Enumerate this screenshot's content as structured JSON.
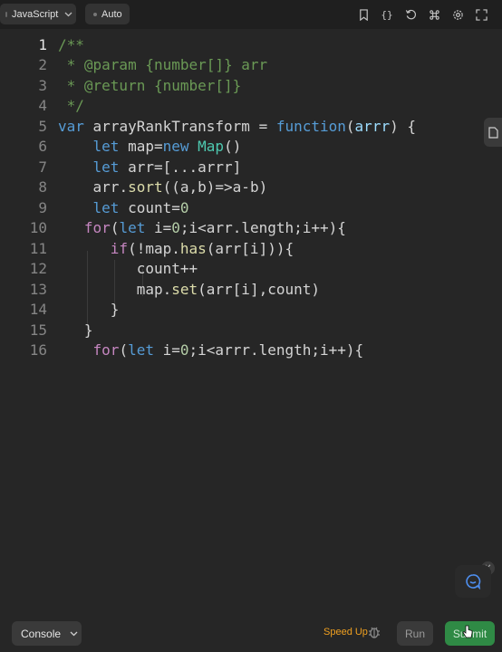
{
  "toolbar": {
    "language_label": "JavaScript",
    "mode_label": "Auto",
    "icons": [
      "bookmark-icon",
      "braces-icon",
      "reset-icon",
      "command-icon",
      "settings-icon",
      "expand-icon"
    ]
  },
  "editor": {
    "active_line": "1",
    "lines": [
      {
        "num": "1",
        "tokens": [
          {
            "t": "/**",
            "c": "#6a9955"
          }
        ]
      },
      {
        "num": "2",
        "tokens": [
          {
            "t": " * @param {number[]} arr",
            "c": "#6a9955"
          }
        ]
      },
      {
        "num": "3",
        "tokens": [
          {
            "t": " * @return {number[]}",
            "c": "#6a9955"
          }
        ]
      },
      {
        "num": "4",
        "tokens": [
          {
            "t": " */",
            "c": "#6a9955"
          }
        ]
      },
      {
        "num": "5",
        "tokens": [
          {
            "t": "var",
            "c": "#569cd6"
          },
          {
            "t": " ",
            "c": "#d4d4d4"
          },
          {
            "t": "arrayRankTransform",
            "c": "#d4d4d4"
          },
          {
            "t": " = ",
            "c": "#d4d4d4"
          },
          {
            "t": "function",
            "c": "#569cd6"
          },
          {
            "t": "(",
            "c": "#d4d4d4"
          },
          {
            "t": "arrr",
            "c": "#9cdcfe"
          },
          {
            "t": ") {",
            "c": "#d4d4d4"
          }
        ]
      },
      {
        "num": "6",
        "tokens": [
          {
            "t": "    ",
            "c": "#d4d4d4"
          },
          {
            "t": "let",
            "c": "#569cd6"
          },
          {
            "t": " map=",
            "c": "#d4d4d4"
          },
          {
            "t": "new",
            "c": "#569cd6"
          },
          {
            "t": " ",
            "c": "#d4d4d4"
          },
          {
            "t": "Map",
            "c": "#4ec9b0"
          },
          {
            "t": "()",
            "c": "#d4d4d4"
          }
        ]
      },
      {
        "num": "7",
        "tokens": [
          {
            "t": "    ",
            "c": "#d4d4d4"
          },
          {
            "t": "let",
            "c": "#569cd6"
          },
          {
            "t": " arr=[...arrr]",
            "c": "#d4d4d4"
          }
        ]
      },
      {
        "num": "8",
        "tokens": [
          {
            "t": "    ",
            "c": "#d4d4d4"
          },
          {
            "t": "arr",
            "c": "#d4d4d4"
          },
          {
            "t": ".",
            "c": "#d4d4d4"
          },
          {
            "t": "sort",
            "c": "#dcdcaa"
          },
          {
            "t": "((a,b)=>a-b)",
            "c": "#d4d4d4"
          }
        ]
      },
      {
        "num": "9",
        "tokens": [
          {
            "t": "    ",
            "c": "#d4d4d4"
          },
          {
            "t": "let",
            "c": "#569cd6"
          },
          {
            "t": " count=",
            "c": "#d4d4d4"
          },
          {
            "t": "0",
            "c": "#b5cea8"
          }
        ]
      },
      {
        "num": "10",
        "tokens": [
          {
            "t": "   ",
            "c": "#d4d4d4"
          },
          {
            "t": "for",
            "c": "#c586c0"
          },
          {
            "t": "(",
            "c": "#d4d4d4"
          },
          {
            "t": "let",
            "c": "#569cd6"
          },
          {
            "t": " i=",
            "c": "#d4d4d4"
          },
          {
            "t": "0",
            "c": "#b5cea8"
          },
          {
            "t": ";i<arr.length;i++){",
            "c": "#d4d4d4"
          }
        ]
      },
      {
        "num": "11",
        "tokens": [
          {
            "t": "      ",
            "c": "#d4d4d4"
          },
          {
            "t": "if",
            "c": "#c586c0"
          },
          {
            "t": "(!map.",
            "c": "#d4d4d4"
          },
          {
            "t": "has",
            "c": "#dcdcaa"
          },
          {
            "t": "(arr[i])){",
            "c": "#d4d4d4"
          }
        ]
      },
      {
        "num": "12",
        "tokens": [
          {
            "t": "         ",
            "c": "#d4d4d4"
          },
          {
            "t": "count++",
            "c": "#d4d4d4"
          }
        ]
      },
      {
        "num": "13",
        "tokens": [
          {
            "t": "         ",
            "c": "#d4d4d4"
          },
          {
            "t": "map.",
            "c": "#d4d4d4"
          },
          {
            "t": "set",
            "c": "#dcdcaa"
          },
          {
            "t": "(arr[i],count)",
            "c": "#d4d4d4"
          }
        ]
      },
      {
        "num": "14",
        "tokens": [
          {
            "t": "      }",
            "c": "#d4d4d4"
          }
        ]
      },
      {
        "num": "15",
        "tokens": [
          {
            "t": "   }",
            "c": "#d4d4d4"
          }
        ]
      },
      {
        "num": "16",
        "tokens": [
          {
            "t": "    ",
            "c": "#d4d4d4"
          },
          {
            "t": "for",
            "c": "#c586c0"
          },
          {
            "t": "(",
            "c": "#d4d4d4"
          },
          {
            "t": "let",
            "c": "#569cd6"
          },
          {
            "t": " i=",
            "c": "#d4d4d4"
          },
          {
            "t": "0",
            "c": "#b5cea8"
          },
          {
            "t": ";i<arrr.length;i++){",
            "c": "#d4d4d4"
          }
        ]
      }
    ]
  },
  "footer": {
    "console_label": "Console",
    "speed_up_label": "Speed Up",
    "run_label": "Run",
    "submit_label": "Submit"
  },
  "colors": {
    "submit": "#2f8a45",
    "speed_up": "#f0a020",
    "background": "#262626"
  }
}
